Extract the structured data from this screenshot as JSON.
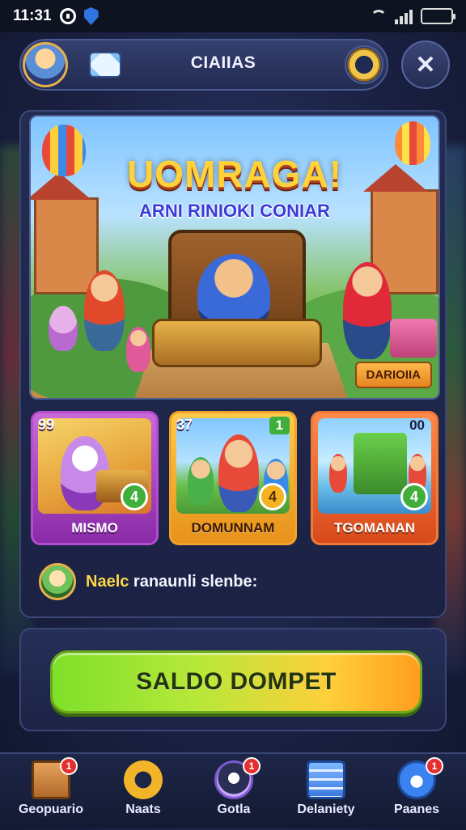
{
  "status_bar": {
    "time": "11:31"
  },
  "top_bar": {
    "title": "CIAIIAS",
    "close_symbol": "✕"
  },
  "banner": {
    "title": "UOMRAGA!",
    "subtitle": "ARNI RINIOKI CONIAR",
    "tag": "DARIOIIA"
  },
  "cards": [
    {
      "count": "99",
      "badge": "",
      "star_value": "4",
      "label": "MISMO"
    },
    {
      "count": "37",
      "badge": "1",
      "star_value": "4",
      "label": "DOMUNNAM"
    },
    {
      "count": "",
      "badge": "00",
      "star_value": "4",
      "label": "TGOMANAN"
    }
  ],
  "message": {
    "highlight": "Naelc",
    "text": " ranaunli slenbe:"
  },
  "wallet_button": {
    "label": "SALDO DOMPET"
  },
  "nav": [
    {
      "label": "Geopuario",
      "badge": "1",
      "icon": "box-icon"
    },
    {
      "label": "Naats",
      "badge": "",
      "icon": "gear-icon"
    },
    {
      "label": "Gotla",
      "badge": "1",
      "icon": "chat-icon"
    },
    {
      "label": "Delaniety",
      "badge": "",
      "icon": "list-icon"
    },
    {
      "label": "Paanes",
      "badge": "1",
      "icon": "pin-icon"
    }
  ],
  "colors": {
    "accent_green": "#7ee02a",
    "accent_orange": "#ff9e1e",
    "panel": "#232c52"
  }
}
